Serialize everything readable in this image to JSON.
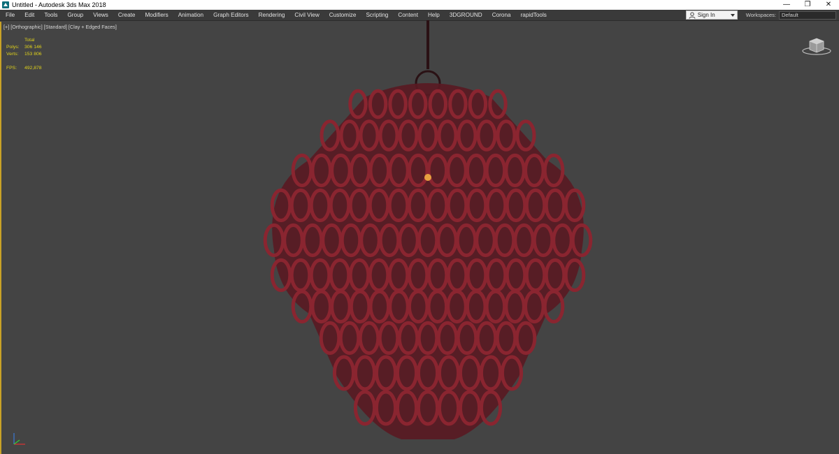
{
  "window": {
    "title": "Untitled - Autodesk 3ds Max 2018",
    "controls": {
      "minimize": "—",
      "restore": "❐",
      "close": "✕"
    }
  },
  "menu": {
    "items": [
      "File",
      "Edit",
      "Tools",
      "Group",
      "Views",
      "Create",
      "Modifiers",
      "Animation",
      "Graph Editors",
      "Rendering",
      "Civil View",
      "Customize",
      "Scripting",
      "Content",
      "Help",
      "3DGROUND",
      "Corona",
      "rapidTools"
    ],
    "sign_in": "Sign In",
    "workspaces_label": "Workspaces:",
    "workspaces_value": "Default"
  },
  "viewport": {
    "labels": [
      "[+]",
      "[Orthographic]",
      "[Standard]",
      "[Clay + Edged Faces]"
    ],
    "stats": {
      "header": "Total",
      "polys_label": "Polys:",
      "polys_value": "306 146",
      "verts_label": "Verts:",
      "verts_value": "153 806",
      "fps_label": "FPS:",
      "fps_value": "492,878"
    },
    "model_color": "#8a2530",
    "border_color": "#c9a227"
  },
  "icons": {
    "app": "3ds-max-icon",
    "user": "user-icon",
    "viewcube": "viewcube-icon",
    "axis": "axis-tripod-icon"
  }
}
